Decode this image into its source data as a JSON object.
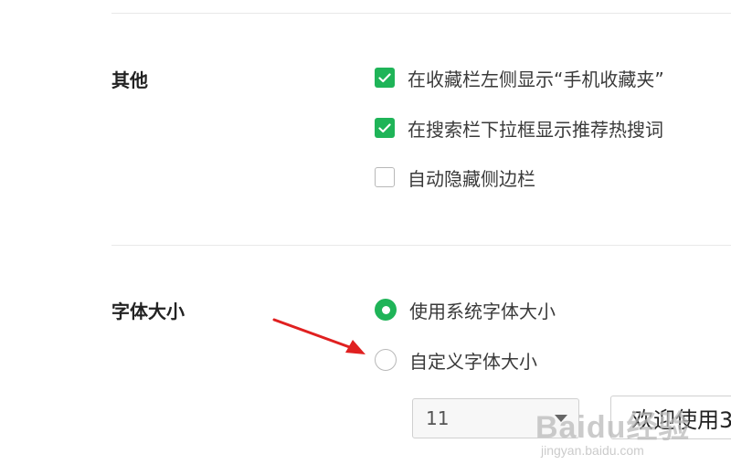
{
  "sections": {
    "other": {
      "title": "其他",
      "options": [
        {
          "label": "在收藏栏左侧显示“手机收藏夹”",
          "checked": true
        },
        {
          "label": "在搜索栏下拉框显示推荐热搜词",
          "checked": true
        },
        {
          "label": "自动隐藏侧边栏",
          "checked": false
        }
      ]
    },
    "font_size": {
      "title": "字体大小",
      "options": [
        {
          "label": "使用系统字体大小",
          "selected": true
        },
        {
          "label": "自定义字体大小",
          "selected": false
        }
      ],
      "size_select": {
        "value": "11"
      },
      "preview_text": "欢迎使用3"
    }
  },
  "annotation": {
    "arrow_color": "#e02020"
  },
  "watermark": {
    "main": "Baidu经验",
    "sub": "jingyan.baidu.com"
  },
  "colors": {
    "accent": "#1fb458",
    "divider": "#e8e8e8"
  },
  "icons": {
    "checkbox_checked": "checkmark-icon",
    "select_caret": "triangle-down-icon"
  }
}
